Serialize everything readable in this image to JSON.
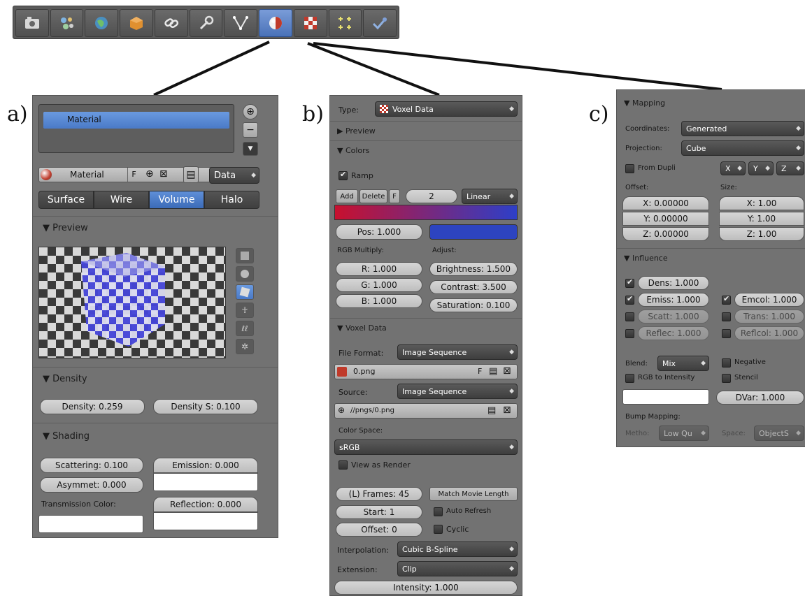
{
  "toolbar": {
    "icons": [
      "render-icon",
      "render-layers-icon",
      "world-icon",
      "object-icon",
      "constraints-icon",
      "modifiers-icon",
      "mesh-data-icon",
      "material-icon",
      "texture-icon",
      "particles-icon",
      "physics-icon"
    ]
  },
  "labels": {
    "a": "a)",
    "b": "b)",
    "c": "c)"
  },
  "panel_a": {
    "material_slot": "Material",
    "material_name": "Material",
    "f_label": "F",
    "data_label": "Data",
    "tabs": [
      "Surface",
      "Wire",
      "Volume",
      "Halo"
    ],
    "preview_header": "▼ Preview",
    "density_header": "▼ Density",
    "density": "Density: 0.259",
    "density_scale": "Density S: 0.100",
    "shading_header": "▼ Shading",
    "scattering": "Scattering: 0.100",
    "emission": "Emission: 0.000",
    "asymmetry": "Asymmet: 0.000",
    "transmission_label": "Transmission Color:",
    "reflection": "Reflection: 0.000"
  },
  "panel_b": {
    "type_label": "Type:",
    "type_value": "Voxel Data",
    "preview_header": "▶ Preview",
    "colors_header": "▼ Colors",
    "ramp_label": "Ramp",
    "add_label": "Add",
    "delete_label": "Delete",
    "f_label": "F",
    "ramp_count": "2",
    "ramp_interp": "Linear",
    "pos": "Pos: 1.000",
    "rgb_multiply_label": "RGB Multiply:",
    "adjust_label": "Adjust:",
    "r_value": "R: 1.000",
    "g_value": "G: 1.000",
    "b_value": "B: 1.000",
    "brightness": "Brightness: 1.500",
    "contrast": "Contrast: 3.500",
    "saturation": "Saturation: 0.100",
    "voxel_header": "▼ Voxel Data",
    "file_format_label": "File Format:",
    "file_format_value": "Image Sequence",
    "image_name": "0.png",
    "source_label": "Source:",
    "source_value": "Image Sequence",
    "source_path": "//pngs/0.png",
    "color_space_label": "Color Space:",
    "color_space_value": "sRGB",
    "view_as_render": "View as Render",
    "frames": "(L) Frames: 45",
    "match_movie": "Match Movie Length",
    "start": "Start: 1",
    "auto_refresh": "Auto Refresh",
    "offset": "Offset: 0",
    "cyclic": "Cyclic",
    "interpolation_label": "Interpolation:",
    "interpolation_value": "Cubic B-Spline",
    "extension_label": "Extension:",
    "extension_value": "Clip",
    "intensity": "Intensity: 1.000"
  },
  "panel_c": {
    "mapping_header": "▼ Mapping",
    "coordinates_label": "Coordinates:",
    "coordinates_value": "Generated",
    "projection_label": "Projection:",
    "projection_value": "Cube",
    "from_dupli": "From Dupli",
    "axis_x": "X",
    "axis_y": "Y",
    "axis_z": "Z",
    "offset_label": "Offset:",
    "size_label": "Size:",
    "offset_x": "X: 0.00000",
    "offset_y": "Y: 0.00000",
    "offset_z": "Z: 0.00000",
    "size_x": "X: 1.00",
    "size_y": "Y: 1.00",
    "size_z": "Z: 1.00",
    "influence_header": "▼ Influence",
    "dens": "Dens: 1.000",
    "emiss": "Emiss: 1.000",
    "emcol": "Emcol: 1.000",
    "scatt": "Scatt: 1.000",
    "trans": "Trans: 1.000",
    "reflec": "Reflec: 1.000",
    "reflcol": "Reflcol: 1.000",
    "blend_label": "Blend:",
    "blend_value": "Mix",
    "negative": "Negative",
    "rgb_to_intensity": "RGB to Intensity",
    "stencil": "Stencil",
    "dvar": "DVar: 1.000",
    "bump_mapping": "Bump Mapping:",
    "method_label": "Metho:",
    "method_value": "Low Qu",
    "space_label": "Space:",
    "space_value": "ObjectS"
  }
}
